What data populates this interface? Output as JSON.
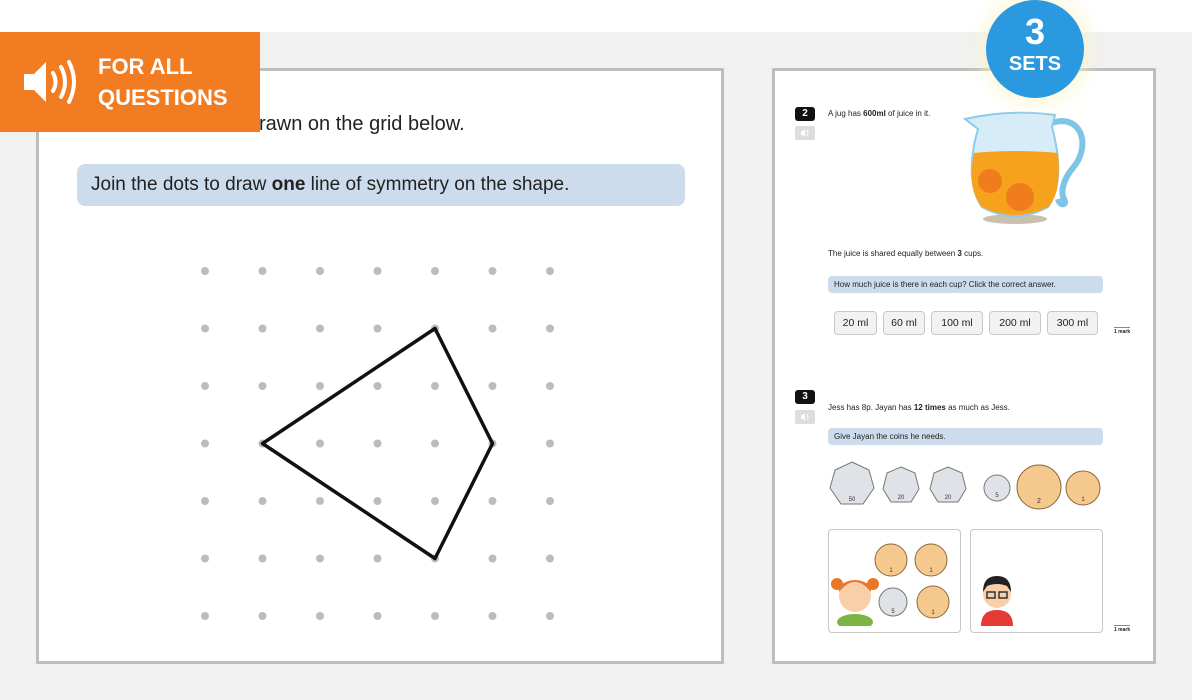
{
  "audio_banner": {
    "line1": "FOR ALL",
    "line2": "QUESTIONS",
    "icon": "speaker-icon"
  },
  "sets_badge": {
    "number": "3",
    "label": "SETS"
  },
  "left_question": {
    "intro_visible": "rawn on the grid below.",
    "prompt_before": "Join the dots to draw ",
    "prompt_bold": "one",
    "prompt_after": " line of symmetry on the shape.",
    "grid": {
      "columns": 7,
      "rows": 7
    },
    "shape_vertices": [
      [
        4,
        1
      ],
      [
        5,
        3
      ],
      [
        4,
        5
      ],
      [
        1,
        3
      ]
    ]
  },
  "right_preview": {
    "q2": {
      "number": "2",
      "text_before": "A jug has ",
      "text_bold": "600ml",
      "text_after": " of juice in it.",
      "shared_before": "The juice is shared equally between ",
      "shared_bold": "3",
      "shared_after": " cups.",
      "prompt": "How much juice is there in each cup? Click the correct answer.",
      "answers": [
        "20 ml",
        "60 ml",
        "100 ml",
        "200 ml",
        "300 ml"
      ],
      "mark": "1 mark"
    },
    "q3": {
      "number": "3",
      "text_before": "Jess has 8p. Jayan has ",
      "text_bold": "12 times",
      "text_after": " as much as Jess.",
      "prompt": "Give Jayan the coins he needs.",
      "coins": [
        "50",
        "20",
        "20",
        "5",
        "2",
        "1"
      ],
      "jess_coins": [
        "1",
        "1",
        "5",
        "1"
      ],
      "mark": "1 mark"
    }
  },
  "colors": {
    "orange": "#f27c22",
    "blue": "#2a99e0",
    "prompt_bg": "#ccdcec"
  }
}
